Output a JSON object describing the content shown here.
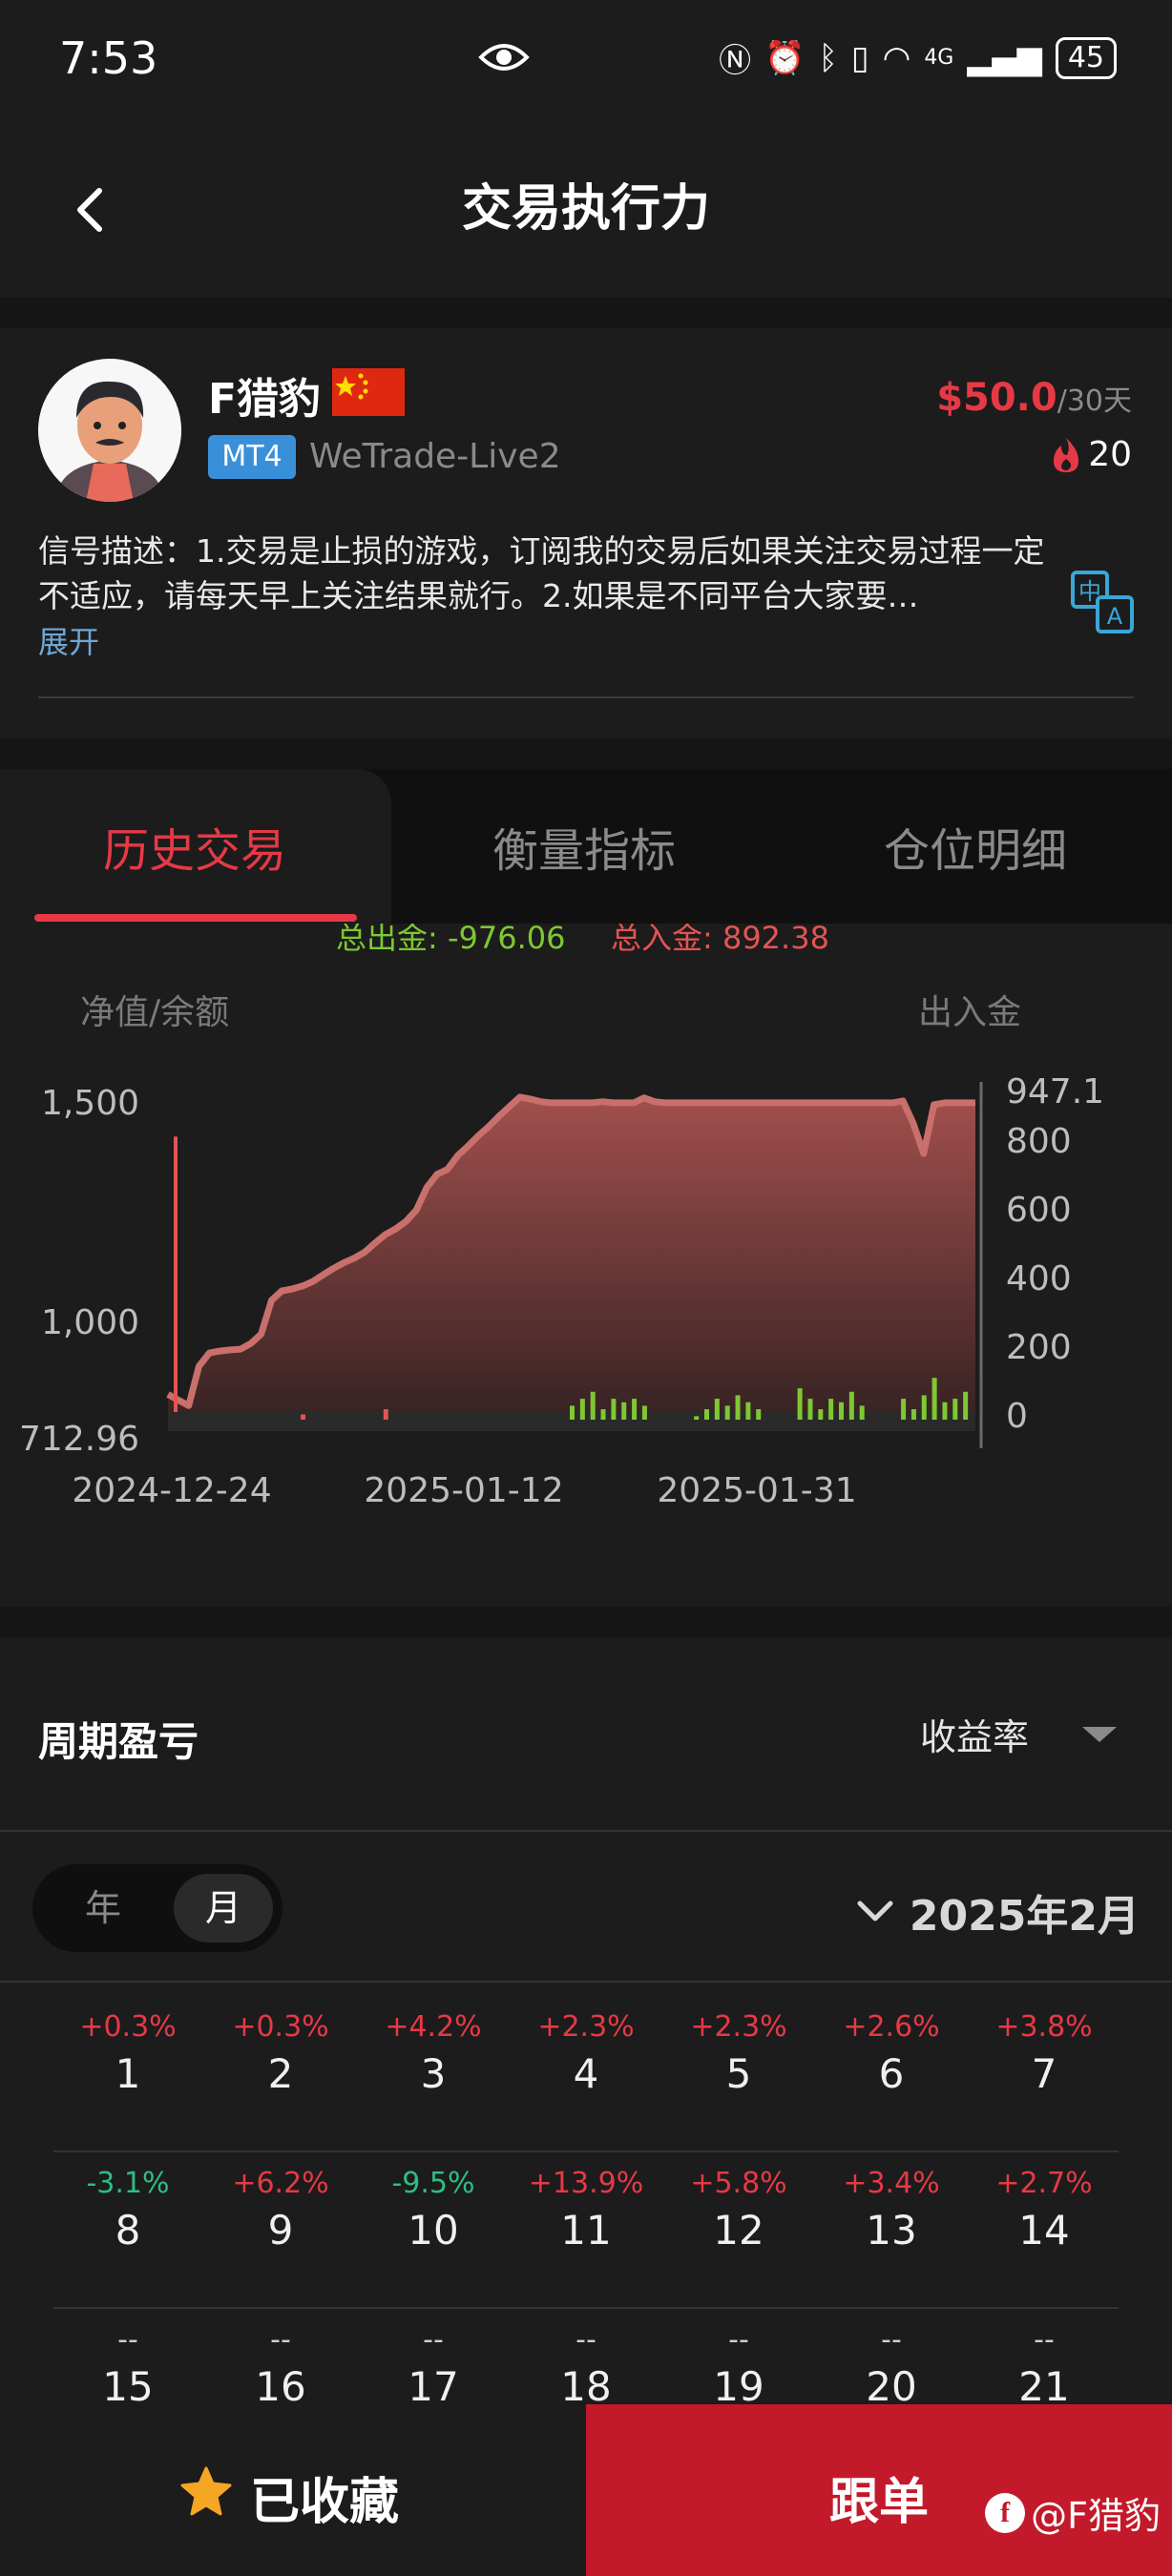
{
  "status_bar": {
    "time": "7:53",
    "network": "4G",
    "battery": "45"
  },
  "header": {
    "title": "交易执行力"
  },
  "profile": {
    "name": "F猎豹",
    "platform": "MT4",
    "server": "WeTrade-Live2",
    "price": "$50.0",
    "price_period": "/30天",
    "fans": "20",
    "description": "信号描述：1.交易是止损的游戏，订阅我的交易后如果关注交易过程一定不适应，请每天早上关注结果就行。2.如果是不同平台大家要…",
    "expand_label": "展开"
  },
  "tabs": [
    {
      "label": "历史交易",
      "active": true
    },
    {
      "label": "衡量指标",
      "active": false
    },
    {
      "label": "仓位明细",
      "active": false
    }
  ],
  "chart_data": {
    "type": "area",
    "summary_out": "总出金: -976.06",
    "summary_in": "总入金: 892.38",
    "left_axis_label": "净值/余额",
    "right_axis_label": "出入金",
    "left_ticks": [
      "1,500",
      "1,000",
      "712.96"
    ],
    "right_ticks": [
      "947.1",
      "800",
      "600",
      "400",
      "200",
      "0"
    ],
    "x_ticks": [
      "2024-12-24",
      "2025-01-12",
      "2025-01-31"
    ],
    "ylim_left": [
      712.96,
      1560
    ],
    "ylim_right": [
      0,
      947.1
    ],
    "colors": {
      "area": "#c96f6c",
      "out": "#7ec832",
      "in": "#e55353",
      "balance_bar": "#e55353"
    },
    "equity": [
      760,
      745,
      730,
      835,
      870,
      875,
      878,
      880,
      895,
      920,
      1010,
      1035,
      1040,
      1048,
      1060,
      1078,
      1095,
      1110,
      1122,
      1138,
      1162,
      1185,
      1200,
      1220,
      1250,
      1310,
      1345,
      1358,
      1395,
      1420,
      1448,
      1472,
      1500,
      1525,
      1550,
      1545,
      1538,
      1535,
      1535,
      1535,
      1535,
      1535,
      1538,
      1535,
      1535,
      1535,
      1548,
      1538,
      1535,
      1535,
      1535,
      1535,
      1535,
      1535,
      1535,
      1535,
      1535,
      1535,
      1535,
      1535,
      1535,
      1535,
      1535,
      1535,
      1535,
      1535,
      1535,
      1535,
      1535,
      1535,
      1535,
      1540,
      1480,
      1400,
      1530,
      1535,
      1535,
      1535,
      1535
    ],
    "cash_out": [
      0,
      0,
      0,
      0,
      0,
      0,
      0,
      0,
      0,
      0,
      0,
      0,
      0,
      0,
      0,
      0,
      0,
      0,
      0,
      0,
      0,
      0,
      0,
      0,
      0,
      0,
      0,
      0,
      0,
      0,
      0,
      0,
      0,
      0,
      0,
      0,
      0,
      0,
      0,
      40,
      60,
      80,
      30,
      60,
      50,
      60,
      40,
      0,
      0,
      0,
      0,
      10,
      30,
      60,
      40,
      70,
      50,
      30,
      0,
      0,
      0,
      90,
      60,
      30,
      60,
      50,
      80,
      40,
      0,
      0,
      0,
      60,
      30,
      70,
      120,
      50,
      60,
      80
    ],
    "cash_in": [
      0,
      0,
      0,
      0,
      0,
      0,
      0,
      0,
      0,
      0,
      0,
      0,
      0,
      15,
      0,
      0,
      0,
      0,
      0,
      0,
      0,
      30,
      0,
      0,
      0,
      0,
      0,
      0,
      0,
      0,
      0,
      0,
      0,
      0,
      0,
      0,
      0,
      0,
      0,
      0,
      0,
      0,
      0,
      0,
      0,
      0,
      0,
      0,
      0,
      0,
      0,
      0,
      0,
      0,
      0,
      0,
      0,
      0,
      0,
      0,
      0,
      0,
      0,
      0,
      0,
      0,
      0,
      0,
      0,
      0,
      0,
      0,
      0,
      0,
      0,
      0,
      0,
      0
    ],
    "balance_spike": 1445
  },
  "period": {
    "title": "周期盈亏",
    "metric": "收益率",
    "toggle": [
      "年",
      "月"
    ],
    "active_toggle": "月",
    "month": "2025年2月",
    "rows": [
      [
        {
          "pct": "+0.3%",
          "day": "1",
          "dir": "up"
        },
        {
          "pct": "+0.3%",
          "day": "2",
          "dir": "up"
        },
        {
          "pct": "+4.2%",
          "day": "3",
          "dir": "up"
        },
        {
          "pct": "+2.3%",
          "day": "4",
          "dir": "up"
        },
        {
          "pct": "+2.3%",
          "day": "5",
          "dir": "up"
        },
        {
          "pct": "+2.6%",
          "day": "6",
          "dir": "up"
        },
        {
          "pct": "+3.8%",
          "day": "7",
          "dir": "up"
        }
      ],
      [
        {
          "pct": "-3.1%",
          "day": "8",
          "dir": "down"
        },
        {
          "pct": "+6.2%",
          "day": "9",
          "dir": "up"
        },
        {
          "pct": "-9.5%",
          "day": "10",
          "dir": "down"
        },
        {
          "pct": "+13.9%",
          "day": "11",
          "dir": "up"
        },
        {
          "pct": "+5.8%",
          "day": "12",
          "dir": "up"
        },
        {
          "pct": "+3.4%",
          "day": "13",
          "dir": "up"
        },
        {
          "pct": "+2.7%",
          "day": "14",
          "dir": "up"
        }
      ],
      [
        {
          "pct": "--",
          "day": "15",
          "dir": "na"
        },
        {
          "pct": "--",
          "day": "16",
          "dir": "na"
        },
        {
          "pct": "--",
          "day": "17",
          "dir": "na"
        },
        {
          "pct": "--",
          "day": "18",
          "dir": "na"
        },
        {
          "pct": "--",
          "day": "19",
          "dir": "na"
        },
        {
          "pct": "--",
          "day": "20",
          "dir": "na"
        },
        {
          "pct": "--",
          "day": "21",
          "dir": "na"
        }
      ]
    ]
  },
  "bottom": {
    "favorite_label": "已收藏",
    "follow_label": "跟单",
    "watermark": "@F猎豹"
  }
}
